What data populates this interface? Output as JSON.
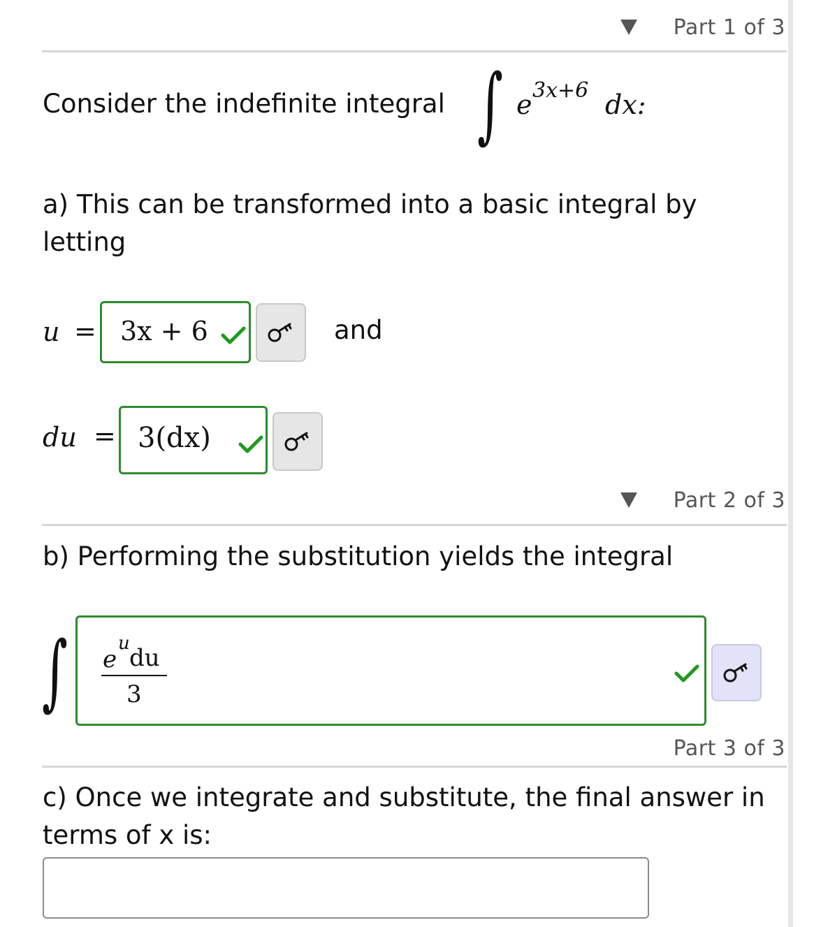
{
  "parts": [
    {
      "label": "Part 1 of 3"
    },
    {
      "label": "Part 2 of 3"
    },
    {
      "label": "Part 3 of 3"
    }
  ],
  "part1": {
    "intro": "Consider the indefinite integral",
    "integrand_base": "e",
    "integrand_exponent": "3x+6",
    "integrand_dx": "dx:",
    "instruction": "a) This can be transformed into a basic integral by letting",
    "u_label": "u",
    "u_equals": "=",
    "u_answer": "3x + 6",
    "and_text": "and",
    "du_label": "du",
    "du_equals": "=",
    "du_answer": "3(dx)"
  },
  "part2": {
    "instruction": "b) Performing the substitution yields the integral",
    "numerator_base": "e",
    "numerator_exponent": "u",
    "numerator_du": "du",
    "denominator": "3"
  },
  "part3": {
    "instruction": "c) Once we integrate and substitute, the final answer in terms of x is:",
    "answer_value": ""
  },
  "icons": {
    "toggle": "triangle-down-icon",
    "check": "checkmark-icon",
    "key": "key-icon"
  },
  "colors": {
    "correct": "#2e8b2e",
    "check": "#1f9a1f",
    "muted_text": "#555555",
    "rule": "#d6d6d6"
  }
}
